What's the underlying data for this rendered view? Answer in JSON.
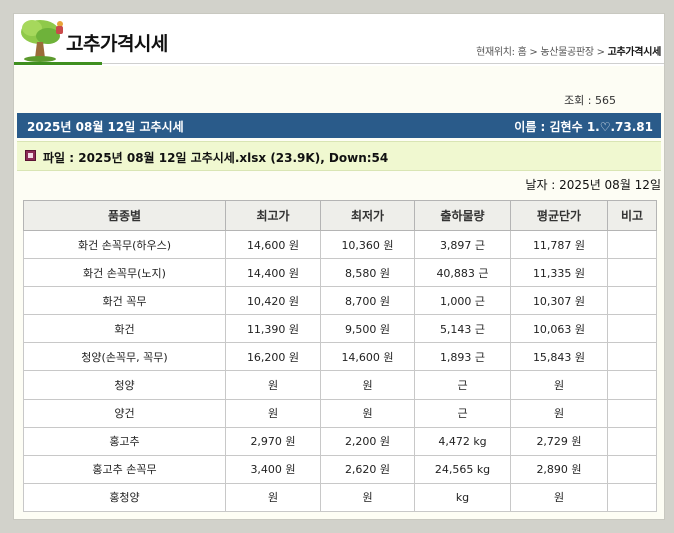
{
  "header": {
    "title": "고추가격시세",
    "breadcrumb_prefix": "현재위치: 홈 > 농산물공판장 > ",
    "breadcrumb_current": "고추가격시세"
  },
  "post": {
    "views_label": "조회 : 565",
    "subject": "2025년 08월 12일 고추시세",
    "author": "이름 : 김현수   1.♡.73.81",
    "file_label": "파일 : 2025년 08월 12일 고추시세.xlsx (23.9K), Down:54",
    "date_label": "날자 : 2025년 08월 12일"
  },
  "table": {
    "columns": [
      "품종별",
      "최고가",
      "최저가",
      "출하물량",
      "평균단가",
      "비고"
    ],
    "rows": [
      [
        "화건 손꼭무(하우스)",
        "14,600 원",
        "10,360 원",
        "3,897 근",
        "11,787 원",
        ""
      ],
      [
        "화건 손꼭무(노지)",
        "14,400 원",
        "8,580 원",
        "40,883 근",
        "11,335 원",
        ""
      ],
      [
        "화건 꼭무",
        "10,420 원",
        "8,700 원",
        "1,000 근",
        "10,307 원",
        ""
      ],
      [
        "화건",
        "11,390 원",
        "9,500 원",
        "5,143 근",
        "10,063 원",
        ""
      ],
      [
        "청양(손꼭무, 꼭무)",
        "16,200 원",
        "14,600 원",
        "1,893 근",
        "15,843 원",
        ""
      ],
      [
        "청양",
        "원",
        "원",
        "근",
        "원",
        ""
      ],
      [
        "양건",
        "원",
        "원",
        "근",
        "원",
        ""
      ],
      [
        "홍고추",
        "2,970 원",
        "2,200 원",
        "4,472 kg",
        "2,729 원",
        ""
      ],
      [
        "홍고추 손꼭무",
        "3,400 원",
        "2,620 원",
        "24,565 kg",
        "2,890 원",
        ""
      ],
      [
        "홍청양",
        "원",
        "원",
        "kg",
        "원",
        ""
      ]
    ]
  },
  "icons": {
    "logo": "tree-icon",
    "file": "file-icon"
  },
  "colors": {
    "bar": "#2a5b8a",
    "file_bg": "#f0f8d0",
    "underline": "#3f8f1f"
  }
}
